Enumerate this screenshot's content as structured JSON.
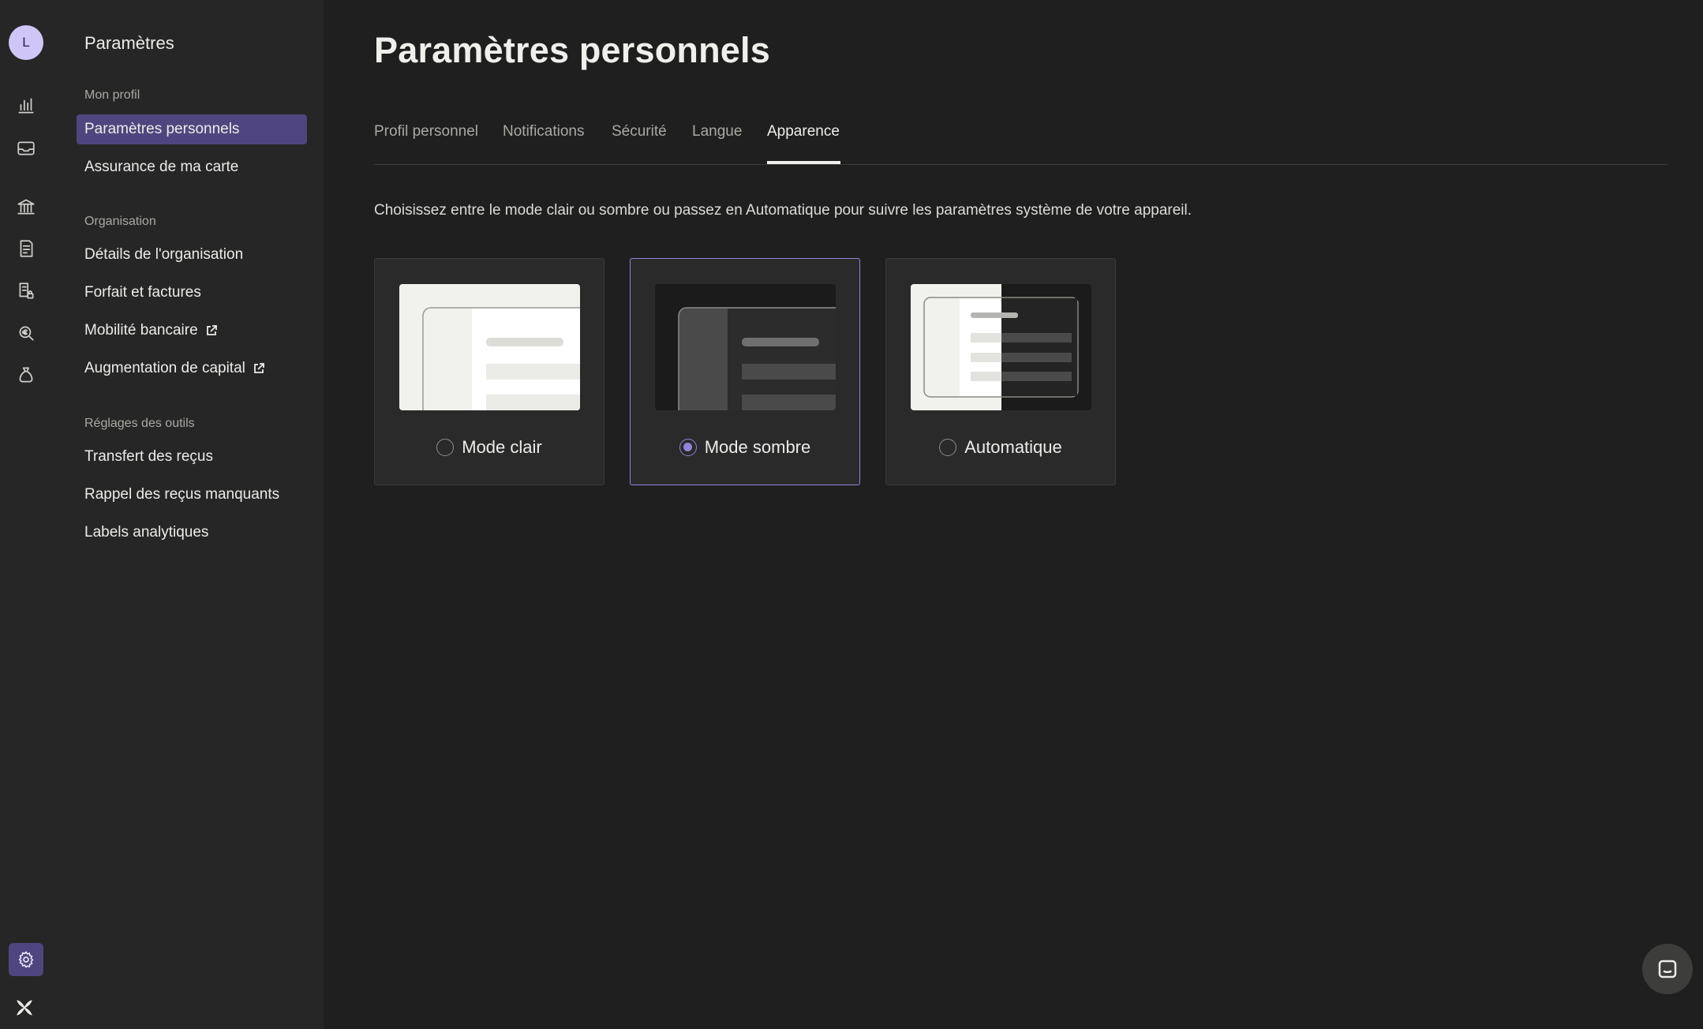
{
  "user": {
    "initial": "L"
  },
  "sidebar": {
    "title": "Paramètres",
    "sections": [
      {
        "label": "Mon profil",
        "items": [
          {
            "label": "Paramètres personnels",
            "active": true,
            "external": false
          },
          {
            "label": "Assurance de ma carte",
            "active": false,
            "external": false
          }
        ]
      },
      {
        "label": "Organisation",
        "items": [
          {
            "label": "Détails de l'organisation",
            "active": false,
            "external": false
          },
          {
            "label": "Forfait et factures",
            "active": false,
            "external": false
          },
          {
            "label": "Mobilité bancaire",
            "active": false,
            "external": true
          },
          {
            "label": "Augmentation de capital",
            "active": false,
            "external": true
          }
        ]
      },
      {
        "label": "Réglages des outils",
        "items": [
          {
            "label": "Transfert des reçus",
            "active": false,
            "external": false
          },
          {
            "label": "Rappel des reçus manquants",
            "active": false,
            "external": false
          },
          {
            "label": "Labels analytiques",
            "active": false,
            "external": false
          }
        ]
      }
    ]
  },
  "rail_icons": [
    "bar-chart-icon",
    "inbox-icon",
    "bank-icon",
    "receipt-icon",
    "locked-documents-icon",
    "money-search-icon",
    "money-bag-icon"
  ],
  "main": {
    "title": "Paramètres personnels",
    "tabs": [
      {
        "label": "Profil personnel",
        "active": false
      },
      {
        "label": "Notifications",
        "active": false
      },
      {
        "label": "Sécurité",
        "active": false
      },
      {
        "label": "Langue",
        "active": false
      },
      {
        "label": "Apparence",
        "active": true
      }
    ],
    "intro": "Choisissez entre le mode clair ou sombre ou passez en Automatique pour suivre les paramètres système de votre appareil.",
    "appearance_options": [
      {
        "label": "Mode clair",
        "selected": false
      },
      {
        "label": "Mode sombre",
        "selected": true
      },
      {
        "label": "Automatique",
        "selected": false
      }
    ]
  },
  "colors": {
    "accent": "#8f86d8",
    "active_bg": "#4f467f",
    "background": "#1f1f1f",
    "sidebar_bg": "#262626"
  }
}
